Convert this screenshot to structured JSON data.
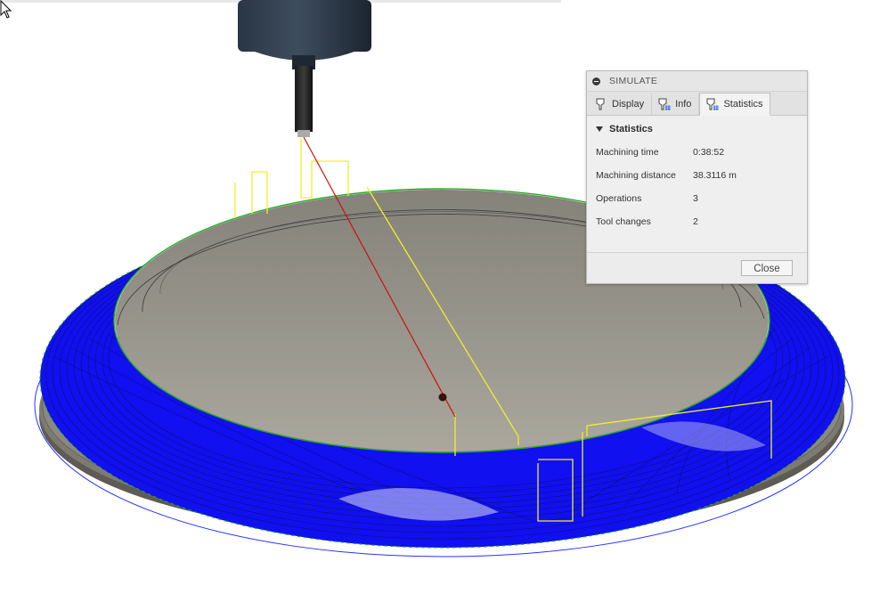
{
  "panel": {
    "title": "SIMULATE",
    "tabs": [
      {
        "label": "Display",
        "icon": "tool-icon"
      },
      {
        "label": "Info",
        "icon": "tool-info-icon"
      },
      {
        "label": "Statistics",
        "icon": "tool-stats-icon",
        "active": true
      }
    ],
    "section_title": "Statistics",
    "stats": [
      {
        "label": "Machining time",
        "value": "0:38:52"
      },
      {
        "label": "Machining distance",
        "value": "38.3116 m"
      },
      {
        "label": "Operations",
        "value": "3"
      },
      {
        "label": "Tool changes",
        "value": "2"
      }
    ],
    "close_label": "Close"
  },
  "colors": {
    "toolpath": "#1a1aff",
    "rapid": "#f0ef2a",
    "plunge": "#cc1111",
    "edge": "#22aa22",
    "stock": "#8d8a80"
  }
}
